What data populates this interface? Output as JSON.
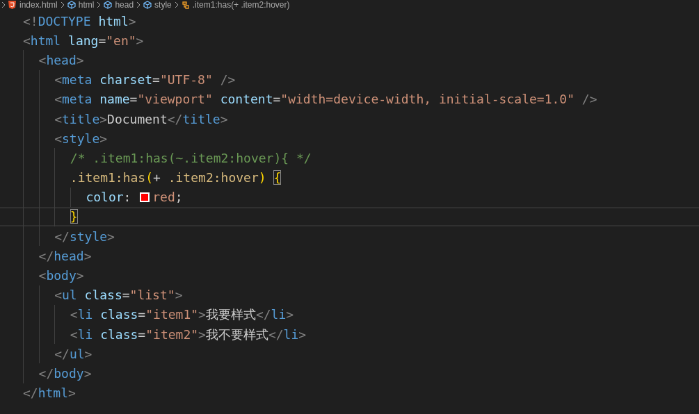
{
  "breadcrumb": [
    {
      "kind": "file",
      "label": "index.html"
    },
    {
      "kind": "element",
      "label": "html"
    },
    {
      "kind": "element",
      "label": "head"
    },
    {
      "kind": "element",
      "label": "style"
    },
    {
      "kind": "rule",
      "label": ".item1:has(+ .item2:hover)"
    }
  ],
  "lines": [
    {
      "current": false,
      "tokens": [
        {
          "kind": "p",
          "text": "<!"
        },
        {
          "kind": "tag",
          "text": "DOCTYPE"
        },
        {
          "kind": "attr",
          "text": " html"
        },
        {
          "kind": "p",
          "text": ">"
        }
      ]
    },
    {
      "current": false,
      "tokens": [
        {
          "kind": "p",
          "text": "<"
        },
        {
          "kind": "tag",
          "text": "html"
        },
        {
          "kind": "attr",
          "text": " lang"
        },
        {
          "kind": "plain",
          "text": "="
        },
        {
          "kind": "str",
          "text": "\"en\""
        },
        {
          "kind": "p",
          "text": ">"
        }
      ],
      "children": [
        {
          "current": false,
          "tokens": [
            {
              "kind": "p",
              "text": "<"
            },
            {
              "kind": "tag",
              "text": "head"
            },
            {
              "kind": "p",
              "text": ">"
            }
          ],
          "children": [
            {
              "current": false,
              "tokens": [
                {
                  "kind": "p",
                  "text": "<"
                },
                {
                  "kind": "tag",
                  "text": "meta"
                },
                {
                  "kind": "attr",
                  "text": " charset"
                },
                {
                  "kind": "plain",
                  "text": "="
                },
                {
                  "kind": "str",
                  "text": "\"UTF-8\""
                },
                {
                  "kind": "p",
                  "text": " />"
                }
              ]
            },
            {
              "current": false,
              "tokens": [
                {
                  "kind": "p",
                  "text": "<"
                },
                {
                  "kind": "tag",
                  "text": "meta"
                },
                {
                  "kind": "attr",
                  "text": " name"
                },
                {
                  "kind": "plain",
                  "text": "="
                },
                {
                  "kind": "str",
                  "text": "\"viewport\""
                },
                {
                  "kind": "attr",
                  "text": " content"
                },
                {
                  "kind": "plain",
                  "text": "="
                },
                {
                  "kind": "str",
                  "text": "\"width=device-width, initial-scale=1.0\""
                },
                {
                  "kind": "p",
                  "text": " />"
                }
              ]
            },
            {
              "current": false,
              "tokens": [
                {
                  "kind": "p",
                  "text": "<"
                },
                {
                  "kind": "tag",
                  "text": "title"
                },
                {
                  "kind": "p",
                  "text": ">"
                },
                {
                  "kind": "plain",
                  "text": "Document"
                },
                {
                  "kind": "p",
                  "text": "</"
                },
                {
                  "kind": "tag",
                  "text": "title"
                },
                {
                  "kind": "p",
                  "text": ">"
                }
              ]
            },
            {
              "current": false,
              "tokens": [
                {
                  "kind": "p",
                  "text": "<"
                },
                {
                  "kind": "tag",
                  "text": "style"
                },
                {
                  "kind": "p",
                  "text": ">"
                }
              ],
              "children": [
                {
                  "current": false,
                  "tokens": [
                    {
                      "kind": "comment",
                      "text": "/* .item1:has(~.item2:hover){ */"
                    }
                  ]
                },
                {
                  "current": false,
                  "tokens": [
                    {
                      "kind": "sel",
                      "text": ".item1:has"
                    },
                    {
                      "kind": "brace",
                      "text": "("
                    },
                    {
                      "kind": "plain",
                      "text": "+"
                    },
                    {
                      "kind": "sel",
                      "text": " .item2:hover"
                    },
                    {
                      "kind": "brace",
                      "text": ") "
                    },
                    {
                      "kind": "match",
                      "text": "{"
                    }
                  ],
                  "children": [
                    {
                      "current": false,
                      "tokens": [
                        {
                          "kind": "prop",
                          "text": "color"
                        },
                        {
                          "kind": "plain",
                          "text": ": "
                        },
                        {
                          "kind": "swatch",
                          "color": "#ff0000"
                        },
                        {
                          "kind": "str",
                          "text": "red"
                        },
                        {
                          "kind": "plain",
                          "text": ";"
                        }
                      ]
                    }
                  ]
                },
                {
                  "current": true,
                  "tokens": [
                    {
                      "kind": "match",
                      "text": "}"
                    }
                  ]
                }
              ]
            },
            {
              "current": false,
              "tokens": [
                {
                  "kind": "p",
                  "text": "</"
                },
                {
                  "kind": "tag",
                  "text": "style"
                },
                {
                  "kind": "p",
                  "text": ">"
                }
              ]
            }
          ]
        },
        {
          "current": false,
          "tokens": [
            {
              "kind": "p",
              "text": "</"
            },
            {
              "kind": "tag",
              "text": "head"
            },
            {
              "kind": "p",
              "text": ">"
            }
          ]
        },
        {
          "current": false,
          "tokens": [
            {
              "kind": "p",
              "text": "<"
            },
            {
              "kind": "tag",
              "text": "body"
            },
            {
              "kind": "p",
              "text": ">"
            }
          ],
          "children": [
            {
              "current": false,
              "tokens": [
                {
                  "kind": "p",
                  "text": "<"
                },
                {
                  "kind": "tag",
                  "text": "ul"
                },
                {
                  "kind": "attr",
                  "text": " class"
                },
                {
                  "kind": "plain",
                  "text": "="
                },
                {
                  "kind": "str",
                  "text": "\"list\""
                },
                {
                  "kind": "p",
                  "text": ">"
                }
              ],
              "children": [
                {
                  "current": false,
                  "tokens": [
                    {
                      "kind": "p",
                      "text": "<"
                    },
                    {
                      "kind": "tag",
                      "text": "li"
                    },
                    {
                      "kind": "attr",
                      "text": " class"
                    },
                    {
                      "kind": "plain",
                      "text": "="
                    },
                    {
                      "kind": "str",
                      "text": "\"item1\""
                    },
                    {
                      "kind": "p",
                      "text": ">"
                    },
                    {
                      "kind": "plain",
                      "text": "我要样式"
                    },
                    {
                      "kind": "p",
                      "text": "</"
                    },
                    {
                      "kind": "tag",
                      "text": "li"
                    },
                    {
                      "kind": "p",
                      "text": ">"
                    }
                  ]
                },
                {
                  "current": false,
                  "tokens": [
                    {
                      "kind": "p",
                      "text": "<"
                    },
                    {
                      "kind": "tag",
                      "text": "li"
                    },
                    {
                      "kind": "attr",
                      "text": " class"
                    },
                    {
                      "kind": "plain",
                      "text": "="
                    },
                    {
                      "kind": "str",
                      "text": "\"item2\""
                    },
                    {
                      "kind": "p",
                      "text": ">"
                    },
                    {
                      "kind": "plain",
                      "text": "我不要样式"
                    },
                    {
                      "kind": "p",
                      "text": "</"
                    },
                    {
                      "kind": "tag",
                      "text": "li"
                    },
                    {
                      "kind": "p",
                      "text": ">"
                    }
                  ]
                }
              ]
            },
            {
              "current": false,
              "tokens": [
                {
                  "kind": "p",
                  "text": "</"
                },
                {
                  "kind": "tag",
                  "text": "ul"
                },
                {
                  "kind": "p",
                  "text": ">"
                }
              ]
            }
          ]
        },
        {
          "current": false,
          "tokens": [
            {
              "kind": "p",
              "text": "</"
            },
            {
              "kind": "tag",
              "text": "body"
            },
            {
              "kind": "p",
              "text": ">"
            }
          ]
        }
      ]
    },
    {
      "current": false,
      "tokens": [
        {
          "kind": "p",
          "text": "</"
        },
        {
          "kind": "tag",
          "text": "html"
        },
        {
          "kind": "p",
          "text": ">"
        }
      ]
    }
  ]
}
